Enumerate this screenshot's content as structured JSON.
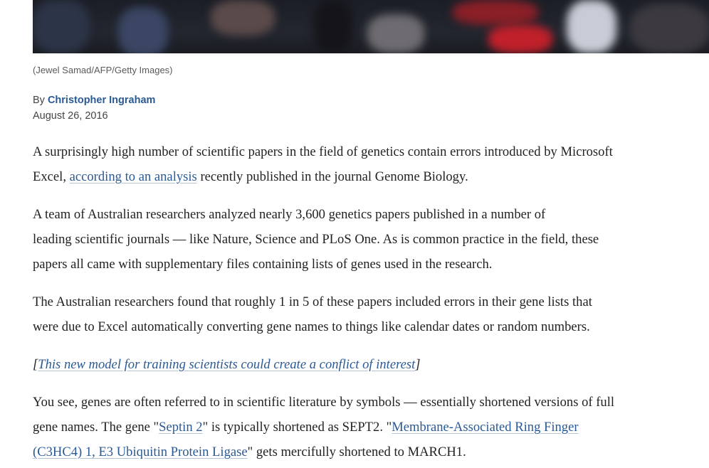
{
  "photo": {
    "caption": "(Jewel Samad/AFP/Getty Images)"
  },
  "byline": {
    "prefix": "By",
    "author": "Christopher Ingraham",
    "date": "August 26, 2016"
  },
  "paragraphs": {
    "p1": {
      "line1": "A surprisingly high number of scientific papers in the field of genetics contain errors introduced by Microsoft",
      "line2_pre": "Excel, ",
      "link": "according to an analysis",
      "line2_post": " recently published in the journal Genome Biology."
    },
    "p2": {
      "line1": "A team of Australian researchers analyzed nearly 3,600 genetics papers published in a number of",
      "line2": "leading scientific journals — like Nature, Science and PLoS One. As is common practice in the field, these",
      "line3": "papers all came with supplementary files containing lists of genes used in the research."
    },
    "p3": {
      "line1": "The Australian researchers found that roughly 1 in 5 of these papers included errors in their gene lists that",
      "line2": "were due to Excel automatically converting gene names to things like calendar dates or random numbers."
    },
    "related": {
      "open": "[",
      "link": "This new model for training scientists could create a conflict of interest",
      "close": "]"
    },
    "p4": {
      "line1": "You see, genes are often referred to in scientific literature by symbols — essentially shortened versions of full",
      "line2_pre": "gene names. The gene \"",
      "link1": "Septin 2",
      "line2_mid": "\" is typically shortened as SEPT2. \"",
      "link2_part1": "Membrane-Associated Ring Finger",
      "link2_part2": "(C3HC4) 1, E3 Ubiquitin Protein Ligase",
      "line3_post": "\" gets mercifully shortened to MARCH1."
    }
  }
}
